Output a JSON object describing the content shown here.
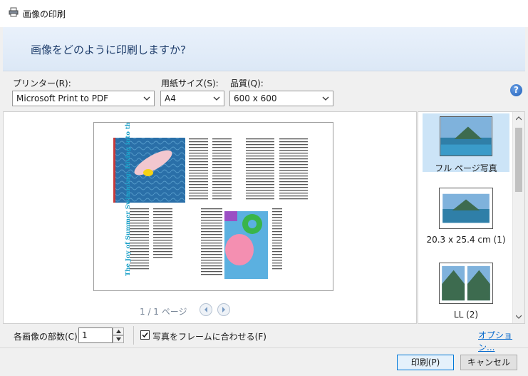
{
  "window": {
    "title": "画像の印刷",
    "question": "画像をどのように印刷しますか?"
  },
  "printer": {
    "label": "プリンター(R):",
    "value": "Microsoft Print to PDF"
  },
  "paper": {
    "label": "用紙サイズ(S):",
    "value": "A4"
  },
  "quality": {
    "label": "品質(Q):",
    "value": "600 x 600"
  },
  "preview": {
    "pager": "1 / 1 ページ",
    "article_title": "The Joy of Summer Swimming: Diving into the Pool 💡"
  },
  "layouts": [
    {
      "label": "フル ページ写真",
      "selected": true
    },
    {
      "label": "20.3 x 25.4 cm (1)",
      "selected": false
    },
    {
      "label": "LL (2)",
      "selected": false
    }
  ],
  "copies": {
    "label": "各画像の部数(C):",
    "value": "1"
  },
  "fit": {
    "label": "写真をフレームに合わせる(F)",
    "checked": true
  },
  "options_link": "オプション...",
  "buttons": {
    "print": "印刷(P)",
    "cancel": "キャンセル"
  }
}
